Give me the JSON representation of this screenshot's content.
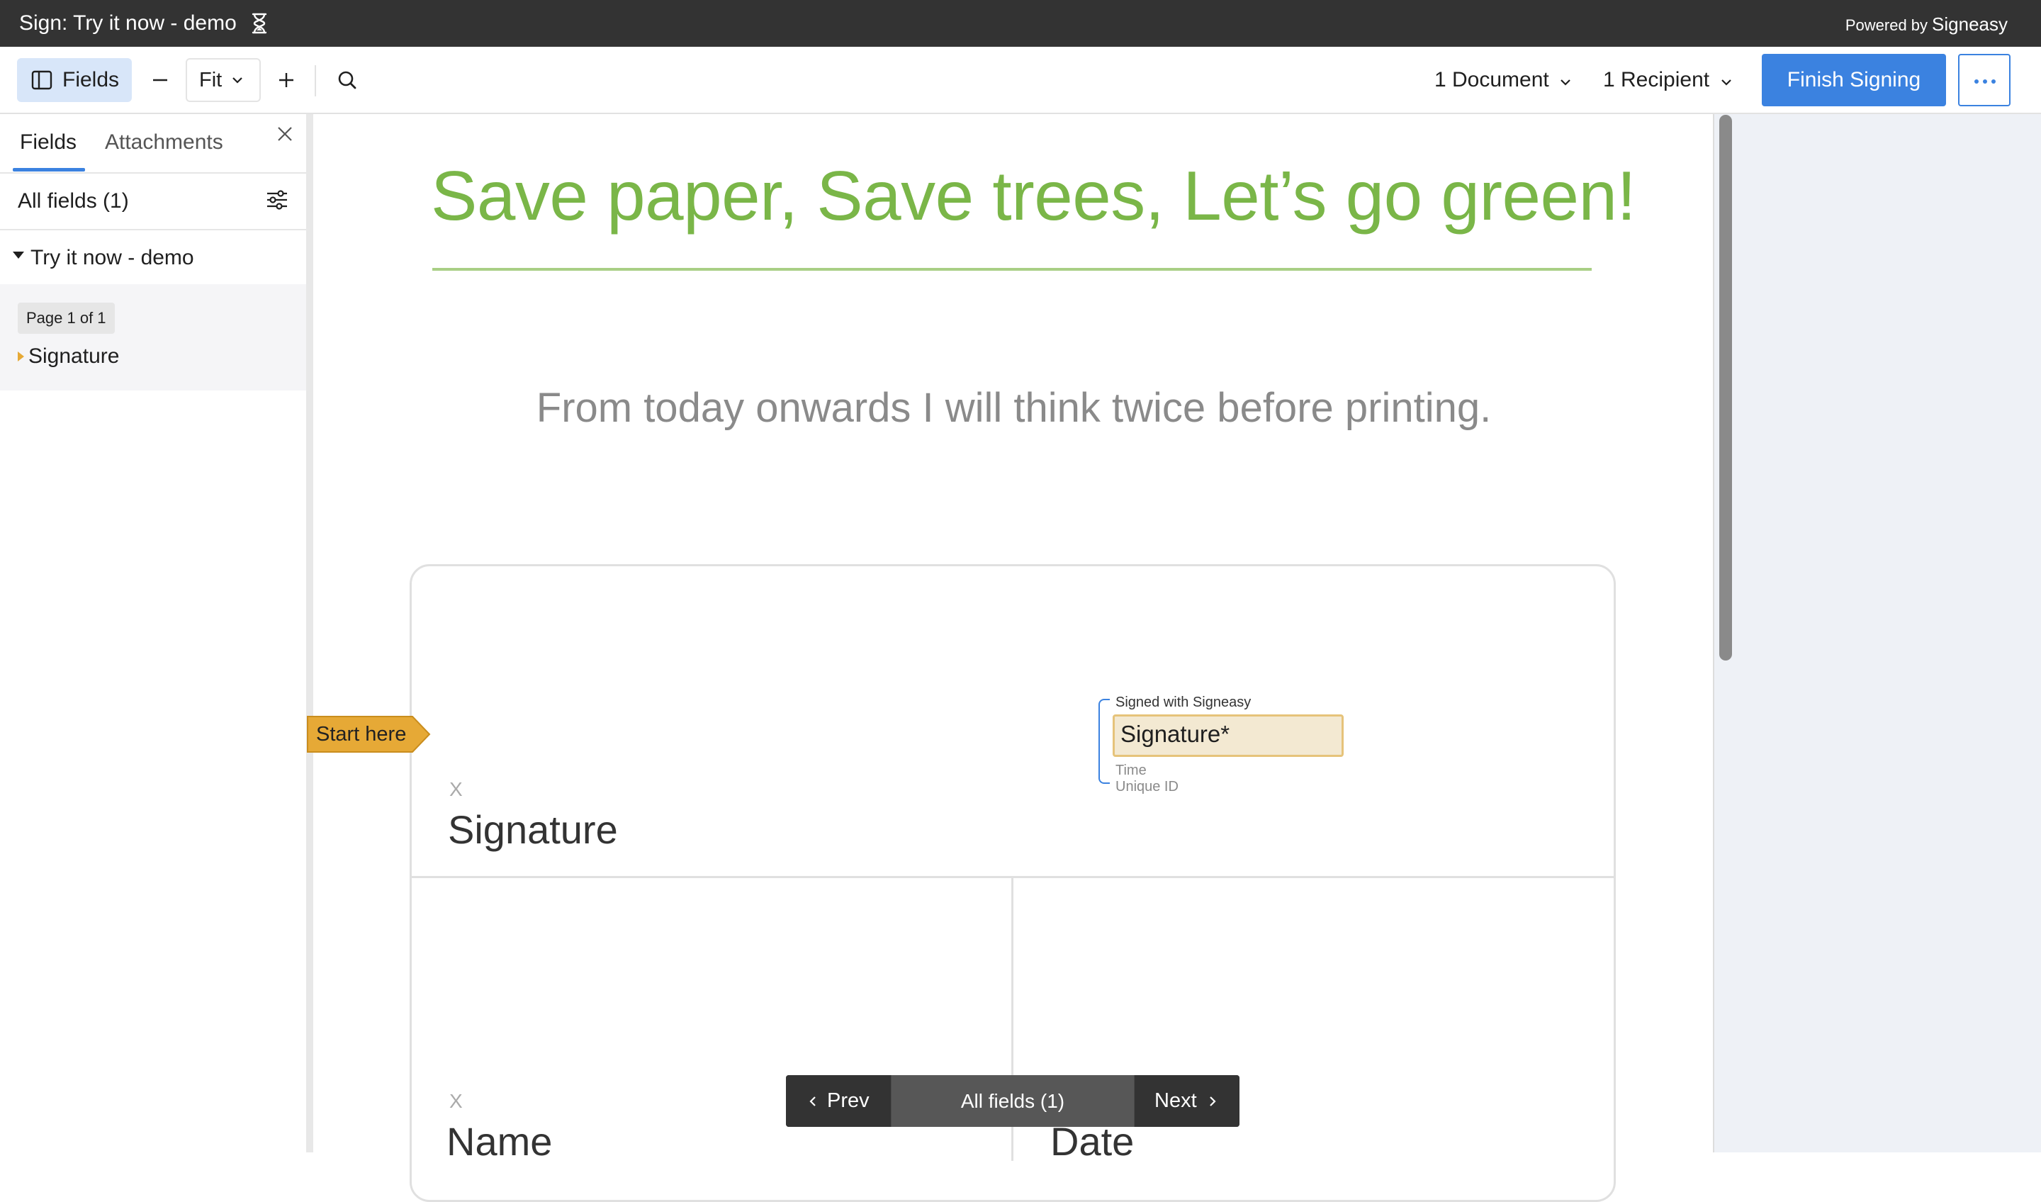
{
  "titlebar": {
    "title": "Sign: Try it now - demo",
    "powered_by_prefix": "Powered by",
    "powered_by_brand": "Signeasy"
  },
  "toolbar": {
    "fields_label": "Fields",
    "zoom_label": "Fit",
    "document_label": "1 Document",
    "recipient_label": "1 Recipient",
    "finish_label": "Finish Signing"
  },
  "sidebar": {
    "tabs": [
      {
        "label": "Fields",
        "active": true
      },
      {
        "label": "Attachments",
        "active": false
      }
    ],
    "all_fields_label": "All fields (1)",
    "document_name": "Try it now - demo",
    "page_badge": "Page 1 of 1",
    "items": [
      {
        "label": "Signature"
      }
    ]
  },
  "document": {
    "headline": "Save paper, Save trees, Let’s go green!",
    "subline": "From today onwards I will think twice before printing.",
    "x_mark": "X",
    "signature_label": "Signature",
    "name_label": "Name",
    "date_label": "Date",
    "signature_field": {
      "caption": "Signed with Signeasy",
      "placeholder": "Signature*",
      "time_label": "Time",
      "uid_label": "Unique ID"
    },
    "start_here_label": "Start here"
  },
  "bottom_nav": {
    "prev_label": "Prev",
    "all_fields_label": "All fields (1)",
    "next_label": "Next"
  },
  "colors": {
    "accent": "#3b82e0",
    "headline_green": "#7ab648",
    "titlebar_bg": "#333333",
    "start_here_bg": "#e6a936",
    "signature_field_bg": "#f3e9d2"
  }
}
